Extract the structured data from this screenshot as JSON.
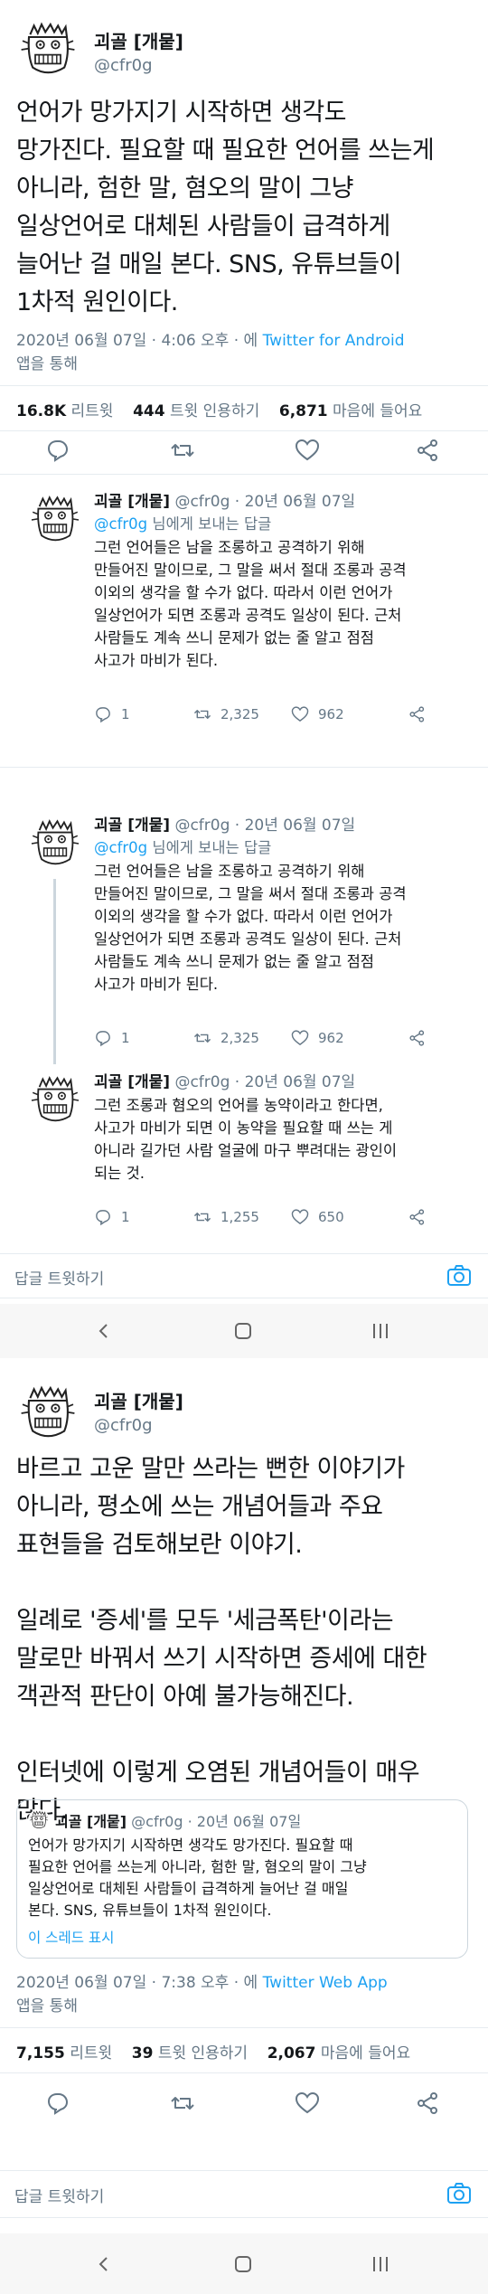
{
  "tweet1": {
    "name": "괴골 [개뭍]",
    "handle": "@cfr0g",
    "text": "언어가 망가지기 시작하면 생각도\n망가진다. 필요할 때 필요한 언어를 쓰는게\n아니라, 험한 말, 혐오의 말이 그냥\n일상언어로 대체된 사람들이 급격하게\n늘어난 걸 매일 본다. SNS, 유튜브들이\n1차적 원인이다.",
    "date": "2020년 06월 07일 · 4:06 오후 · 에",
    "client": "Twitter for Android",
    "via": "앱을 통해",
    "stats": {
      "retweets": "16.8K",
      "retweets_label": "리트윗",
      "quotes": "444",
      "quotes_label": "트윗 인용하기",
      "likes": "6,871",
      "likes_label": "마음에 들어요"
    }
  },
  "replies": [
    {
      "name": "괴골 [개뭍]",
      "handle_date": "@cfr0g · 20년 06월 07일",
      "reply_to": "@cfr0g",
      "reply_suffix": "님에게 보내는 답글",
      "text": "그런 언어들은 남을 조롱하고 공격하기 위해\n만들어진 말이므로, 그 말을 써서 절대 조롱과 공격\n이외의 생각을 할 수가 없다. 따라서 이런 언어가\n일상언어가 되면 조롱과 공격도 일상이 된다. 근처\n사람들도 계속 쓰니 문제가 없는 줄 알고 점점\n사고가 마비가 된다.",
      "replies": "1",
      "retweets": "2,325",
      "likes": "962"
    },
    {
      "name": "괴골 [개뭍]",
      "handle_date": "@cfr0g · 20년 06월 07일",
      "reply_to": "@cfr0g",
      "reply_suffix": "님에게 보내는 답글",
      "text": "그런 언어들은 남을 조롱하고 공격하기 위해\n만들어진 말이므로, 그 말을 써서 절대 조롱과 공격\n이외의 생각을 할 수가 없다. 따라서 이런 언어가\n일상언어가 되면 조롱과 공격도 일상이 된다. 근처\n사람들도 계속 쓰니 문제가 없는 줄 알고 점점\n사고가 마비가 된다.",
      "replies": "1",
      "retweets": "2,325",
      "likes": "962"
    },
    {
      "name": "괴골 [개뭍]",
      "handle_date": "@cfr0g · 20년 06월 07일",
      "text": "그런 조롱과 혐오의 언어를 농약이라고 한다면,\n사고가 마비가 되면 이 농약을 필요할 때 쓰는 게\n아니라 길가던 사람 얼굴에 마구 뿌려대는 광인이\n되는 것.",
      "replies": "1",
      "retweets": "1,255",
      "likes": "650"
    }
  ],
  "reply_bar": {
    "placeholder": "답글 트윗하기"
  },
  "tweet2": {
    "name": "괴골 [개뭍]",
    "handle": "@cfr0g",
    "text": "바르고 고운 말만 쓰라는 뻔한 이야기가\n아니라, 평소에 쓰는 개념어들과 주요\n표현들을 검토해보란 이야기.\n\n일례로 '증세'를 모두 '세금폭탄'이라는\n말로만 바꿔서 쓰기 시작하면 증세에 대한\n객관적 판단이 아예 불가능해진다.\n\n인터넷에 이렇게 오염된 개념어들이 매우\n많다.",
    "quote": {
      "name": "괴골 [개뭍]",
      "handle_date": "@cfr0g · 20년 06월 07일",
      "text": "언어가 망가지기 시작하면 생각도 망가진다. 필요할 때\n필요한 언어를 쓰는게 아니라, 험한 말, 혐오의 말이 그냥\n일상언어로 대체된 사람들이 급격하게 늘어난 걸 매일\n본다. SNS, 유튜브들이 1차적 원인이다.",
      "show_thread": "이 스레드 표시"
    },
    "date": "2020년 06월 07일 · 7:38 오후 · 에",
    "client": "Twitter Web App",
    "via": "앱을 통해",
    "stats": {
      "retweets": "7,155",
      "retweets_label": "리트윗",
      "quotes": "39",
      "quotes_label": "트윗 인용하기",
      "likes": "2,067",
      "likes_label": "마음에 들어요"
    }
  },
  "colors": {
    "accent": "#1da1f2",
    "text": "#14171a",
    "secondary": "#657786",
    "border": "#e6ecf0"
  },
  "icons": [
    "avatar-doodle",
    "reply-icon",
    "retweet-icon",
    "like-icon",
    "share-icon",
    "camera-icon",
    "nav-back-icon",
    "nav-home-icon",
    "nav-recent-icon"
  ]
}
